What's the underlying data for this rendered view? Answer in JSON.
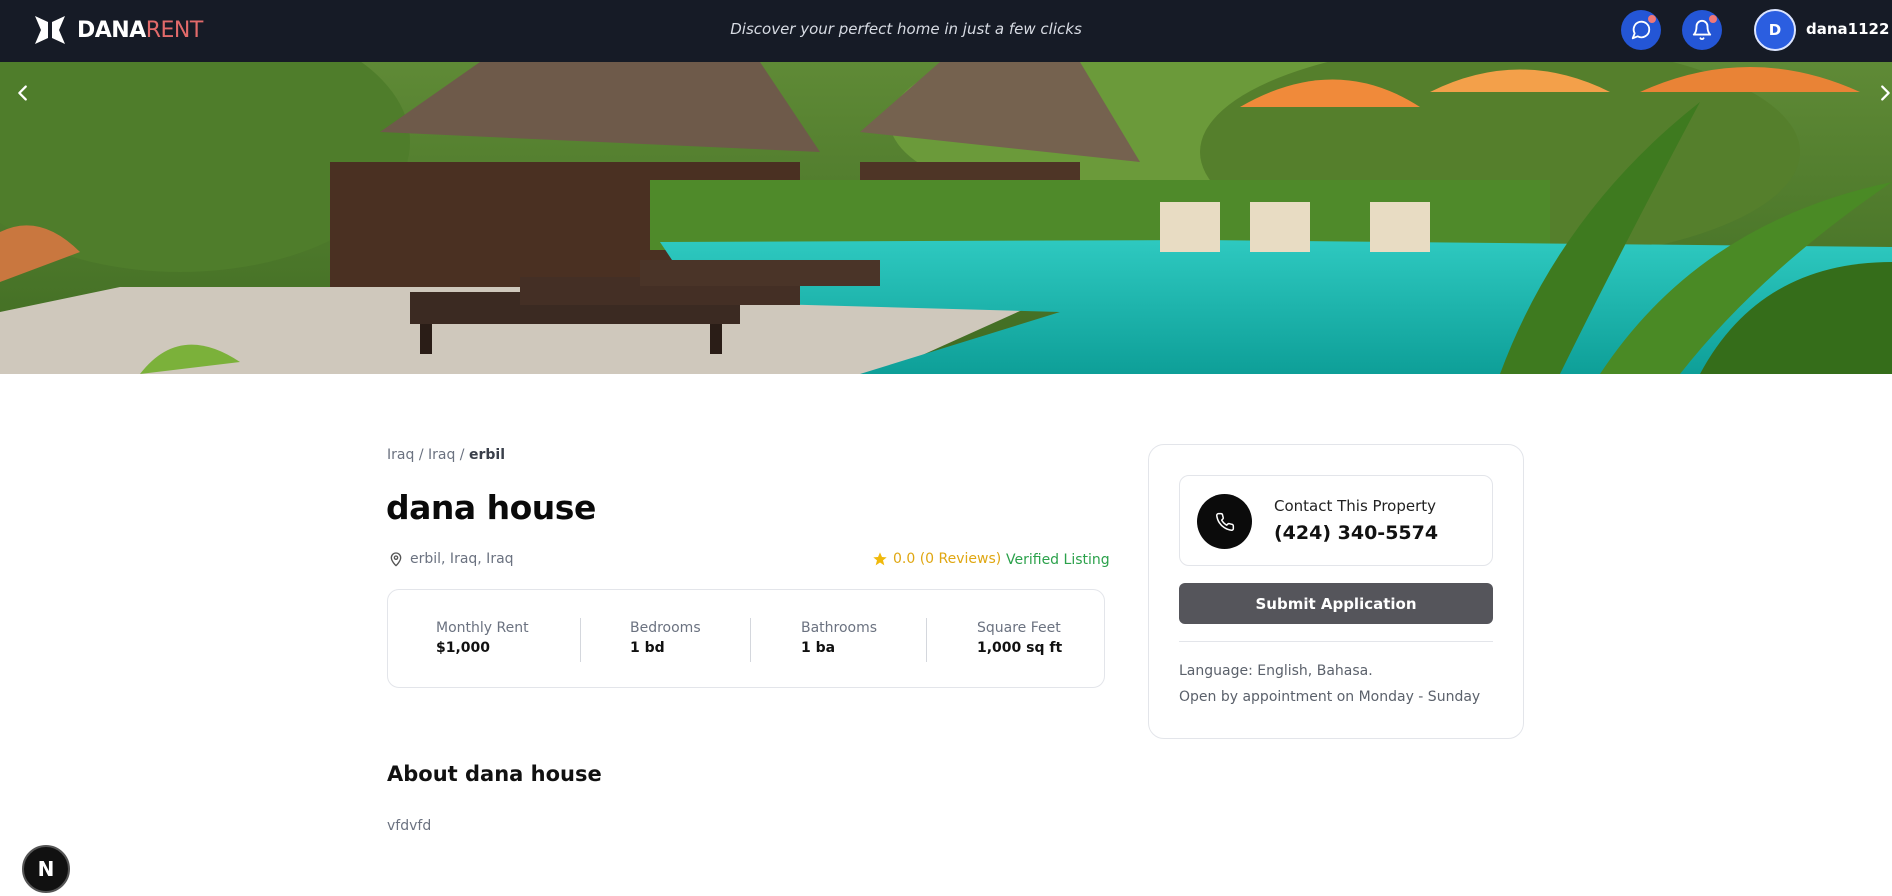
{
  "navbar": {
    "logo_main": "DANA",
    "logo_accent": "RENT",
    "tagline": "Discover your perfect home in just a few clicks",
    "avatar_initial": "D",
    "username": "dana1122",
    "icons": [
      "chat-icon",
      "bell-icon"
    ]
  },
  "hero": {
    "image": "resort-pool-with-loungers",
    "prev_icon": "chevron-left-icon",
    "next_icon": "chevron-right-icon"
  },
  "breadcrumb": {
    "items": [
      "Iraq",
      "Iraq",
      "erbil"
    ],
    "separator": "/"
  },
  "property": {
    "title": "dana house",
    "location": "erbil, Iraq, Iraq",
    "rating": "0.0 (0 Reviews)",
    "verified": "Verified Listing"
  },
  "stats": [
    {
      "label": "Monthly Rent",
      "value": "$1,000"
    },
    {
      "label": "Bedrooms",
      "value": "1 bd"
    },
    {
      "label": "Bathrooms",
      "value": "1 ba"
    },
    {
      "label": "Square Feet",
      "value": "1,000 sq ft"
    }
  ],
  "about": {
    "title": "About dana house",
    "text": "vfdvfd"
  },
  "contact": {
    "label": "Contact This Property",
    "phone": "(424) 340-5574",
    "submit_label": "Submit Application",
    "language": "Language: English, Bahasa.",
    "hours": "Open by appointment on Monday - Sunday"
  },
  "badge": {
    "text": "N"
  },
  "colors": {
    "navbar": "#161b26",
    "accent_blue": "#2456d6",
    "logo_accent": "#e26a6a",
    "star": "#e0a712",
    "verified": "#2ba14b",
    "submit": "#55555b"
  }
}
